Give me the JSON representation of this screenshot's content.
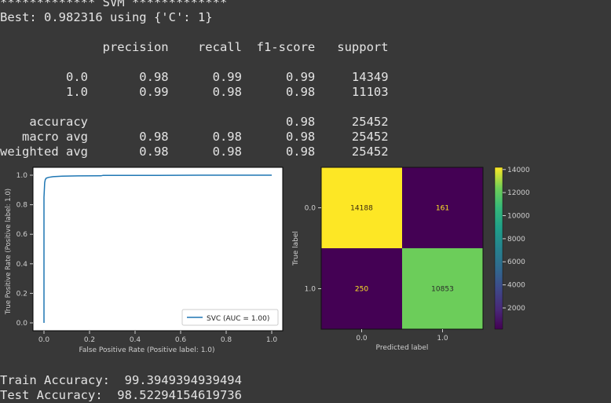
{
  "output": {
    "lines": [
      "************* SVM *************",
      "Best: 0.982316 using {'C': 1}",
      "",
      "              precision    recall  f1-score   support",
      "",
      "         0.0       0.98      0.99      0.99     14349",
      "         1.0       0.99      0.98      0.98     11103",
      "",
      "    accuracy                           0.98     25452",
      "   macro avg       0.98      0.98      0.98     25452",
      "weighted avg       0.98      0.98      0.98     25452"
    ],
    "footer": [
      "Train Accuracy:  99.3949394939494",
      "Test Accuracy:  98.52294154619736"
    ]
  },
  "chart_data": [
    {
      "type": "line",
      "xlabel": "False Positive Rate (Positive label: 1.0)",
      "ylabel": "True Positive Rate (Positive label: 1.0)",
      "xlim": [
        0.0,
        1.0
      ],
      "ylim": [
        0.0,
        1.0
      ],
      "xticks": [
        "0.0",
        "0.2",
        "0.4",
        "0.6",
        "0.8",
        "1.0"
      ],
      "yticks": [
        "0.0",
        "0.2",
        "0.4",
        "0.6",
        "0.8",
        "1.0"
      ],
      "legend": "bottom-right",
      "series": [
        {
          "name": "SVC (AUC = 1.00)",
          "color": "#1f77b4",
          "x": [
            0.0,
            0.0,
            0.003,
            0.006,
            0.01,
            0.02,
            0.04,
            0.08,
            0.15,
            0.25,
            0.26,
            0.5,
            0.75,
            1.0
          ],
          "y": [
            0.0,
            0.85,
            0.95,
            0.97,
            0.98,
            0.985,
            0.99,
            0.993,
            0.995,
            0.996,
            0.999,
            0.999,
            1.0,
            1.0
          ]
        }
      ]
    },
    {
      "type": "heatmap",
      "xlabel": "Predicted label",
      "ylabel": "True label",
      "x_categories": [
        "0.0",
        "1.0"
      ],
      "y_categories": [
        "0.0",
        "1.0"
      ],
      "values": [
        [
          14188,
          161
        ],
        [
          250,
          10853
        ]
      ],
      "colorbar_ticks": [
        "14000",
        "12000",
        "10000",
        "8000",
        "6000",
        "4000",
        "2000"
      ],
      "colorbar_range": [
        161,
        14188
      ],
      "cell_colors": [
        [
          "#fde725",
          "#440154"
        ],
        [
          "#440154",
          "#6ccd5a"
        ]
      ],
      "text_colors": [
        [
          "#3a2a10",
          "#fde725"
        ],
        [
          "#fde725",
          "#2a2a2a"
        ]
      ]
    }
  ]
}
